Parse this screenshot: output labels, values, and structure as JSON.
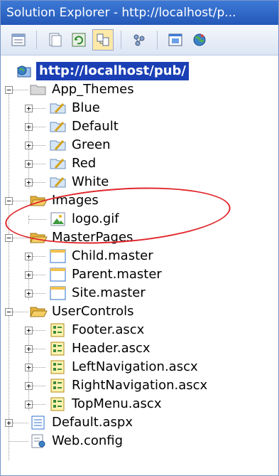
{
  "window": {
    "title": "Solution Explorer - http://localhost/p..."
  },
  "toolbar": {
    "buttons": [
      {
        "name": "properties-icon"
      },
      {
        "name": "show-all-files-icon"
      },
      {
        "name": "refresh-icon"
      },
      {
        "name": "nest-related-files-icon"
      },
      {
        "name": "copy-website-icon"
      },
      {
        "name": "view-designer-icon"
      },
      {
        "name": "aspnet-configuration-icon"
      }
    ]
  },
  "tree": {
    "root": "http://localhost/pub/",
    "items": [
      {
        "label": "App_Themes",
        "type": "folder"
      },
      {
        "label": "Blue",
        "type": "theme"
      },
      {
        "label": "Default",
        "type": "theme"
      },
      {
        "label": "Green",
        "type": "theme"
      },
      {
        "label": "Red",
        "type": "theme"
      },
      {
        "label": "White",
        "type": "theme"
      },
      {
        "label": "Images",
        "type": "folder-open"
      },
      {
        "label": "logo.gif",
        "type": "image"
      },
      {
        "label": "MasterPages",
        "type": "folder-open"
      },
      {
        "label": "Child.master",
        "type": "master"
      },
      {
        "label": "Parent.master",
        "type": "master"
      },
      {
        "label": "Site.master",
        "type": "master"
      },
      {
        "label": "UserControls",
        "type": "folder-open"
      },
      {
        "label": "Footer.ascx",
        "type": "control"
      },
      {
        "label": "Header.ascx",
        "type": "control"
      },
      {
        "label": "LeftNavigation.ascx",
        "type": "control"
      },
      {
        "label": "RightNavigation.ascx",
        "type": "control"
      },
      {
        "label": "TopMenu.ascx",
        "type": "control"
      },
      {
        "label": "Default.aspx",
        "type": "aspx"
      },
      {
        "label": "Web.config",
        "type": "config"
      }
    ]
  },
  "colors": {
    "title_bar": "#2f68c8",
    "root_highlight": "#1a3fb5",
    "annotation": "#e0262b",
    "folder": "#f2c24f"
  }
}
